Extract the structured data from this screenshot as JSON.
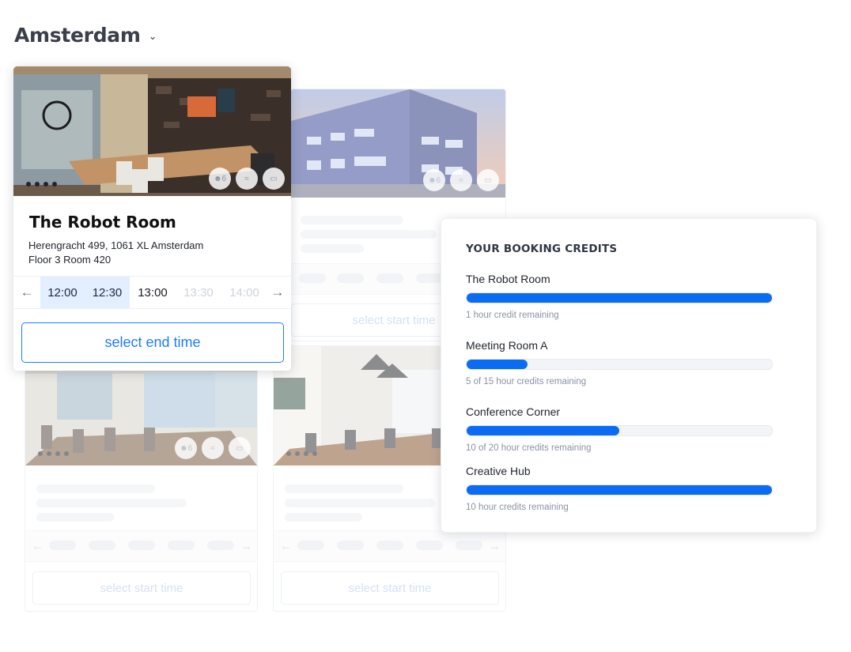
{
  "location": {
    "city": "Amsterdam"
  },
  "featured_room": {
    "name": "The Robot Room",
    "address_line1": "Herengracht 499, 1061 XL Amsterdam",
    "address_line2": "Floor 3 Room 420",
    "capacity": "6",
    "times": [
      {
        "label": "12:00",
        "state": "selected"
      },
      {
        "label": "12:30",
        "state": "selected"
      },
      {
        "label": "13:00",
        "state": "available"
      },
      {
        "label": "13:30",
        "state": "disabled"
      },
      {
        "label": "14:00",
        "state": "disabled"
      }
    ],
    "end_button": "select end time"
  },
  "other_cards": {
    "capacity": "6",
    "start_button": "select start time"
  },
  "credits": {
    "heading": "YOUR BOOKING CREDITS",
    "items": [
      {
        "name": "The Robot Room",
        "remaining_text": "1 hour credit remaining",
        "fill": 1.0
      },
      {
        "name": "Meeting Room A",
        "remaining_text": "5 of 15 hour credits remaining",
        "fill": 0.2
      },
      {
        "name": "Conference Corner",
        "remaining_text": "10 of 20 hour credits remaining",
        "fill": 0.5
      },
      {
        "name": "Creative Hub",
        "remaining_text": "10 hour credits remaining",
        "fill": 1.0
      }
    ]
  },
  "colors": {
    "accent": "#0b6bf2",
    "button_border": "#1f7bff",
    "selected_slot": "#e3efff"
  }
}
